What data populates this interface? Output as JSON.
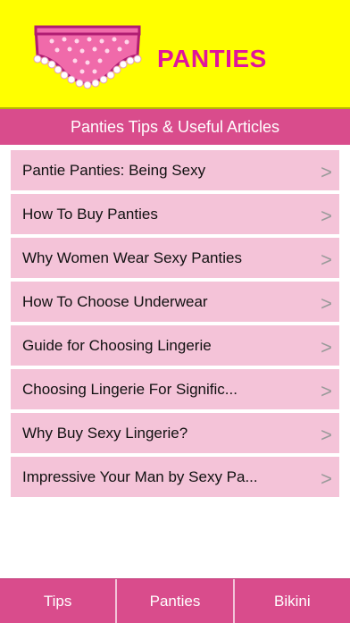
{
  "header": {
    "title": "PANTIES"
  },
  "subheader": {
    "title": "Panties Tips & Useful Articles"
  },
  "articles": [
    {
      "label": "Pantie Panties: Being Sexy"
    },
    {
      "label": "How To Buy Panties"
    },
    {
      "label": "Why Women Wear Sexy Panties"
    },
    {
      "label": "How To Choose Underwear"
    },
    {
      "label": "Guide for Choosing Lingerie"
    },
    {
      "label": "Choosing Lingerie For Signific..."
    },
    {
      "label": "Why Buy Sexy Lingerie?"
    },
    {
      "label": "Impressive Your Man by Sexy Pa..."
    }
  ],
  "chevron": ">",
  "tabs": [
    {
      "label": "Tips"
    },
    {
      "label": "Panties"
    },
    {
      "label": "Bikini"
    }
  ],
  "colors": {
    "header_bg": "#ffff00",
    "brand_pink": "#e0159c",
    "bar_pink": "#d94c8c",
    "item_pink": "#f4c3d8"
  },
  "icons": {
    "logo": "panties-logo-icon",
    "chevron": "chevron-right-icon"
  }
}
